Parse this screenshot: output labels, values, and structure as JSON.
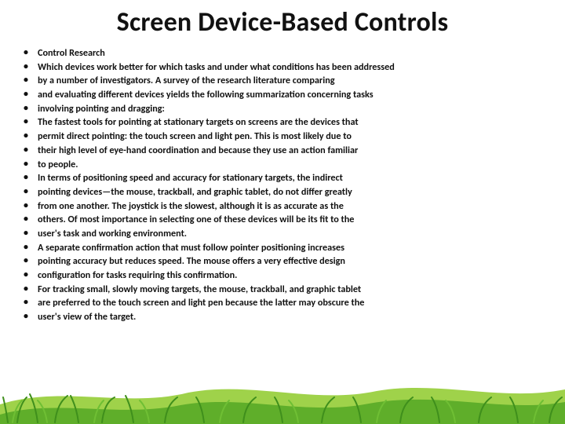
{
  "title": "Screen Device-Based Controls",
  "bullets": [
    "Control Research",
    "Which devices work better for which tasks and under what conditions has been addressed",
    "by a number of investigators. A survey of the research literature comparing",
    "and evaluating different devices yields the following summarization concerning tasks",
    "involving pointing and dragging:",
    "The fastest tools for pointing at stationary targets on screens are the devices that",
    "permit direct pointing: the touch screen and light pen. This is most likely due to",
    "their high level of eye-hand coordination and because they use an action familiar",
    "to people.",
    "In terms of positioning speed and accuracy for stationary targets, the indirect",
    "pointing devices—the mouse, trackball, and graphic tablet, do not differ greatly",
    "from one another. The joystick is the slowest, although it is as accurate as the",
    "others. Of most importance in selecting one of these devices will be its fit to the",
    "user's task and working environment.",
    "A separate confirmation action that must follow pointer positioning increases",
    "pointing accuracy but reduces speed. The mouse offers a very effective design",
    "configuration for tasks requiring this confirmation.",
    "For tracking small, slowly moving targets, the mouse, trackball, and graphic tablet",
    "are preferred to the touch screen and light pen because the latter may obscure the",
    "user's view of the target."
  ]
}
